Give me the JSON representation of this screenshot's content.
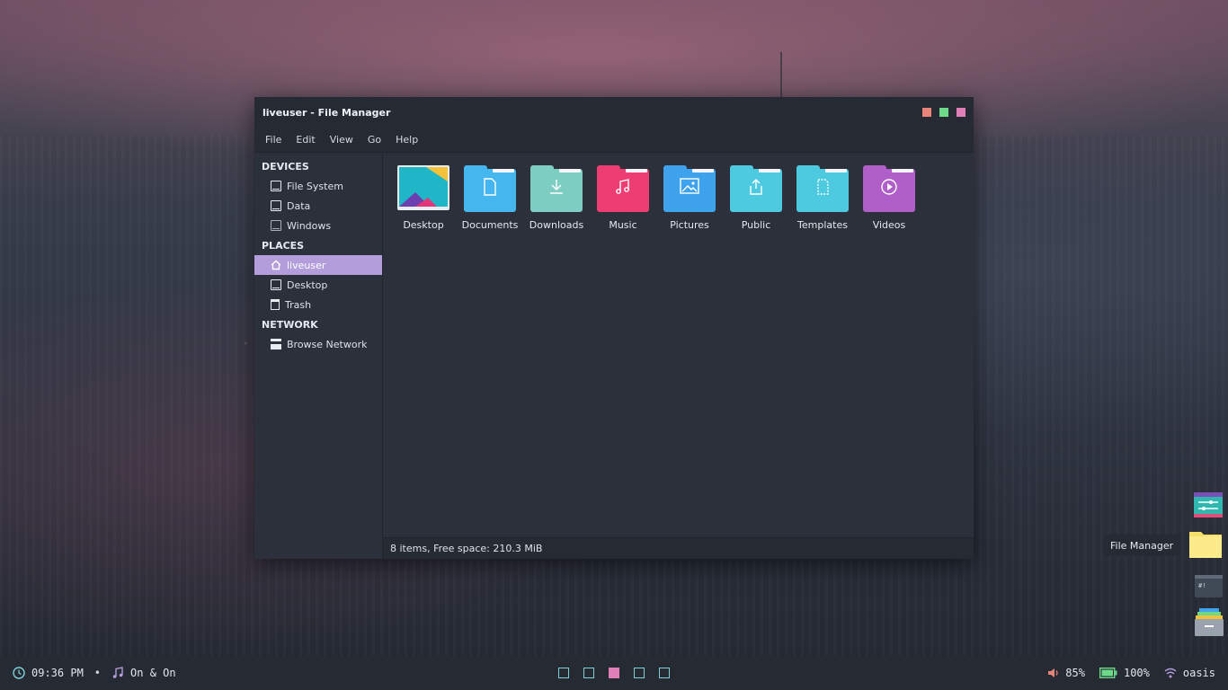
{
  "window": {
    "title": "liveuser - File Manager",
    "controls": {
      "minimize_color": "#e8847a",
      "maximize_color": "#6fd98a",
      "close_color": "#e07fb8"
    }
  },
  "menu": [
    "File",
    "Edit",
    "View",
    "Go",
    "Help"
  ],
  "sidebar": {
    "devices_header": "DEVICES",
    "devices": [
      "File System",
      "Data",
      "Windows"
    ],
    "places_header": "PLACES",
    "places": [
      "liveuser",
      "Desktop",
      "Trash"
    ],
    "network_header": "NETWORK",
    "network": [
      "Browse Network"
    ],
    "active_item": "liveuser",
    "active_color": "#b39ddb"
  },
  "folders": [
    {
      "label": "Desktop",
      "color": "#2ec4c4",
      "icon": "desktop-wallpaper-icon"
    },
    {
      "label": "Documents",
      "color": "#45b6ee",
      "icon": "document-icon"
    },
    {
      "label": "Downloads",
      "color": "#7ecdc2",
      "icon": "download-icon"
    },
    {
      "label": "Music",
      "color": "#ee3d73",
      "icon": "music-note-icon"
    },
    {
      "label": "Pictures",
      "color": "#3fa2ec",
      "icon": "image-icon"
    },
    {
      "label": "Public",
      "color": "#4dc9e0",
      "icon": "share-icon"
    },
    {
      "label": "Templates",
      "color": "#4dc9e0",
      "icon": "template-icon"
    },
    {
      "label": "Videos",
      "color": "#b05fc9",
      "icon": "play-icon"
    }
  ],
  "statusbar": {
    "text": "8 items, Free space: 210.3 MiB"
  },
  "dock": {
    "tooltip": "File Manager"
  },
  "taskbar": {
    "time": "09:36 PM",
    "separator": "•",
    "music": "On & On",
    "workspaces": 5,
    "active_workspace": 3,
    "volume": "85%",
    "battery": "100%",
    "network": "oasis"
  }
}
